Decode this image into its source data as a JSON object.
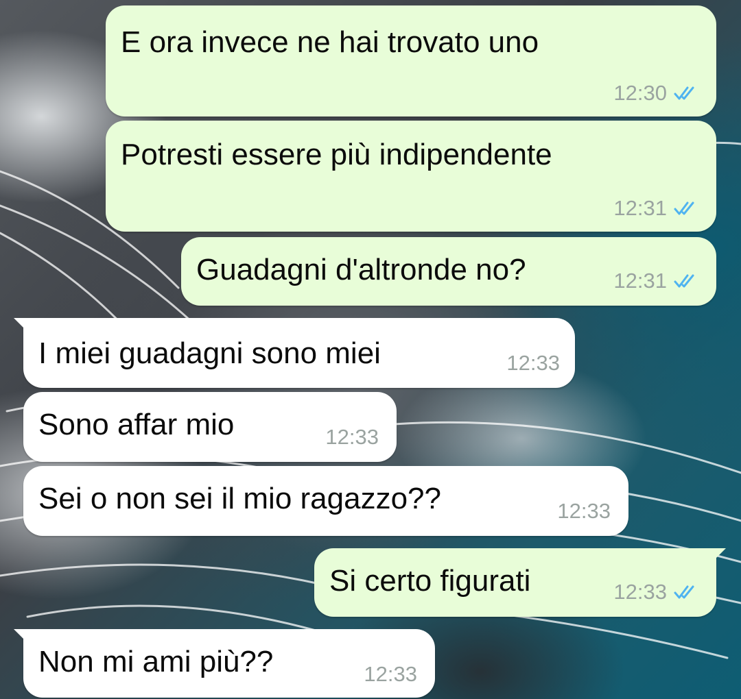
{
  "chat": {
    "messages": [
      {
        "direction": "outgoing",
        "text": "E ora invece ne hai trovato uno",
        "time": "12:30",
        "status": "read"
      },
      {
        "direction": "outgoing",
        "text": "Potresti essere più indipendente",
        "time": "12:31",
        "status": "read"
      },
      {
        "direction": "outgoing",
        "text": "Guadagni d'altronde no?",
        "time": "12:31",
        "status": "read"
      },
      {
        "direction": "incoming",
        "text": "I miei guadagni sono miei",
        "time": "12:33"
      },
      {
        "direction": "incoming",
        "text": "Sono affar mio",
        "time": "12:33"
      },
      {
        "direction": "incoming",
        "text": "Sei o non sei il mio ragazzo??",
        "time": "12:33"
      },
      {
        "direction": "outgoing",
        "text": "Si certo figurati",
        "time": "12:33",
        "status": "read"
      },
      {
        "direction": "incoming",
        "text": "Non mi ami più??",
        "time": "12:33"
      }
    ]
  },
  "colors": {
    "outgoing_bubble": "#e8fdd8",
    "incoming_bubble": "#ffffff",
    "timestamp": "#9aa3a0",
    "read_ticks": "#4fb3f0"
  },
  "icons": {
    "read_receipt": "double-check-icon"
  }
}
